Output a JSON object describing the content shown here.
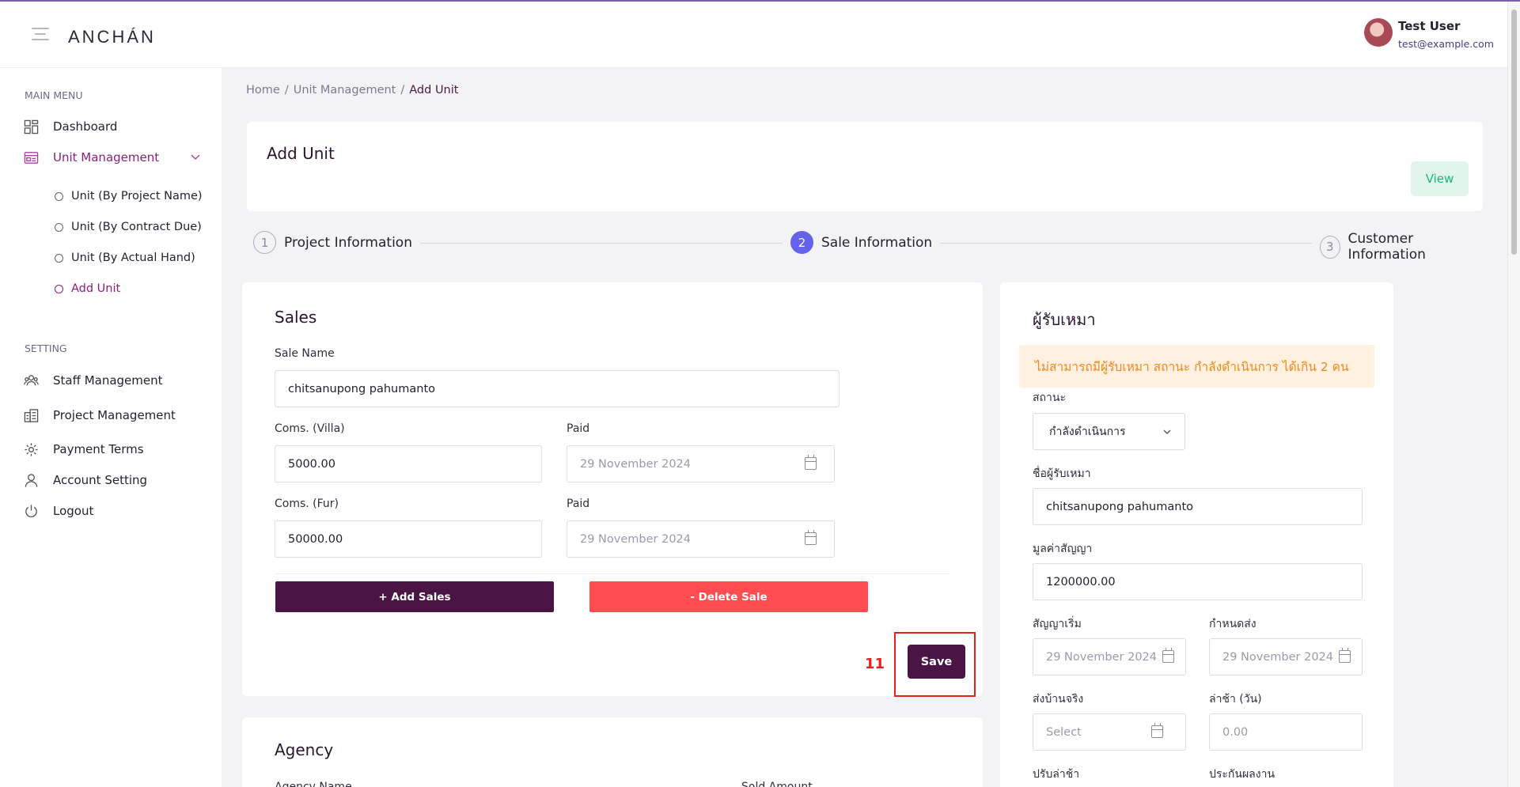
{
  "header": {
    "logo": "ANCHÁN",
    "user_name": "Test User",
    "user_email": "test@example.com"
  },
  "sidebar": {
    "main_menu_heading": "MAIN MENU",
    "setting_heading": "SETTING",
    "items": {
      "dashboard": "Dashboard",
      "unit_management": "Unit Management",
      "staff_management": "Staff Management",
      "project_management": "Project Management",
      "payment_terms": "Payment Terms",
      "account_setting": "Account Setting",
      "logout": "Logout"
    },
    "sub_items": {
      "by_project": "Unit (By Project Name)",
      "by_contract": "Unit (By Contract Due)",
      "by_actual": "Unit (By Actual Hand)",
      "add_unit": "Add Unit"
    }
  },
  "breadcrumb": {
    "home": "Home",
    "unit_management": "Unit Management",
    "current": "Add Unit",
    "sep": "/"
  },
  "page": {
    "title": "Add Unit",
    "view_button": "View"
  },
  "stepper": [
    {
      "num": "1",
      "label": "Project Information"
    },
    {
      "num": "2",
      "label": "Sale Information"
    },
    {
      "num": "3",
      "label": "Customer Information"
    }
  ],
  "sales": {
    "title": "Sales",
    "sale_name_label": "Sale Name",
    "sale_name_value": "chitsanupong pahumanto",
    "coms_villa_label": "Coms. (Villa)",
    "coms_villa_value": "5000.00",
    "paid_label": "Paid",
    "paid_villa_value": "29 November 2024",
    "coms_fur_label": "Coms. (Fur)",
    "coms_fur_value": "50000.00",
    "paid_fur_value": "29 November 2024",
    "add_sales_button": "+ Add Sales",
    "delete_sale_button": "- Delete Sale",
    "save_button": "Save",
    "marker": "11"
  },
  "agency": {
    "title": "Agency",
    "agency_name_label": "Agency Name",
    "sold_amount_label": "Sold Amount"
  },
  "tenant": {
    "title": "ผู้รับเหมา",
    "warning": "ไม่สามารถมีผู้รับเหมา สถานะ กำลังดำเนินการ ได้เกิน 2 คน",
    "status_label": "สถานะ",
    "status_value": "กำลังดำเนินการ",
    "name_label": "ชื่อผู้รับเหมา",
    "name_value": "chitsanupong pahumanto",
    "contract_value_label": "มูลค่าสัญญา",
    "contract_value": "1200000.00",
    "start_label": "สัญญาเริ่ม",
    "start_value": "29 November 2024",
    "due_label": "กำหนดส่ง",
    "due_value": "29 November 2024",
    "actual_label": "ส่งบ้านจริง",
    "actual_placeholder": "Select",
    "late_label": "ล่าช้า (วัน)",
    "late_placeholder": "0.00",
    "penalty_label": "ปรับล่าช้า",
    "warranty_label": "ประกันผลงาน"
  }
}
